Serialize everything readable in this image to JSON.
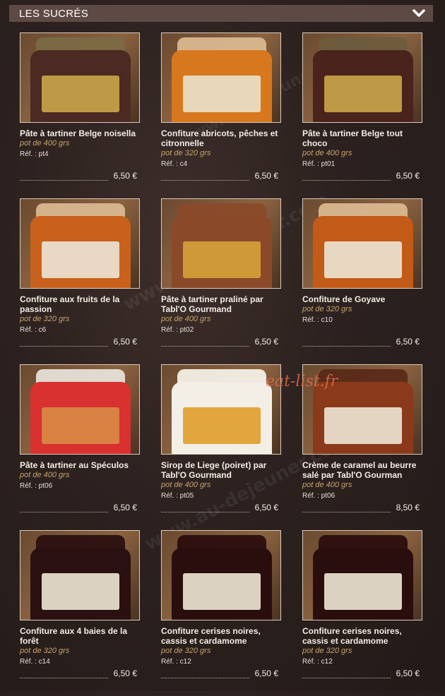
{
  "section": {
    "title": "LES SUCRÉS"
  },
  "watermark": "www.au-dejeuner.com",
  "overlay_logo": "eat-list.fr",
  "products": [
    {
      "name": "Pâte à tartiner Belge noisella",
      "weight": "pot de 400 grs",
      "ref": "Réf. : pt4",
      "price": "6,50 €",
      "jar": "#4a2a22",
      "label": "#c8a44a",
      "lid": "#7a6a44"
    },
    {
      "name": "Confiture abricots, pêches et citronnelle",
      "weight": "pot de 320 grs",
      "ref": "Réf. : c4",
      "price": "6,50 €",
      "jar": "#d7781e",
      "label": "#eadfc8",
      "lid": "#d9b890"
    },
    {
      "name": "Pâte à tartiner Belge tout choco",
      "weight": "pot de 400 grs",
      "ref": "Réf. : pt01",
      "price": "6,50 €",
      "jar": "#4a241c",
      "label": "#c8a44a",
      "lid": "#6d5c3d"
    },
    {
      "name": "Confiture aux fruits de la passion",
      "weight": "pot de 320 grs",
      "ref": "Réf. : c6",
      "price": "6,50 €",
      "jar": "#c8611c",
      "label": "#ece3d1",
      "lid": "#d9b890"
    },
    {
      "name": "Pâte à tartiner praliné par Tabl'O Gourmand",
      "weight": "pot de 400 grs",
      "ref": "Réf. : pt02",
      "price": "6,50 €",
      "jar": "#8a4a2a",
      "label": "#d6a03a",
      "lid": "#8a4a2a"
    },
    {
      "name": "Confiture de Goyave",
      "weight": "pot de 320 grs",
      "ref": "Réf. : c10",
      "price": "6,50 €",
      "jar": "#c25a18",
      "label": "#ece3d1",
      "lid": "#d9b890"
    },
    {
      "name": "Pâte à tartiner au Spéculos",
      "weight": "pot de 400 grs",
      "ref": "Réf. : pt06",
      "price": "6,50 €",
      "jar": "#d93030",
      "label": "#d98a45",
      "lid": "#e6e0d8"
    },
    {
      "name": "Sirop de Liege (poiret) par Tabl'O Gourmand",
      "weight": "pot de 400 grs",
      "ref": "Réf. : pt05",
      "price": "6,50 €",
      "jar": "#f3efe6",
      "label": "#e0a030",
      "lid": "#f3efe6"
    },
    {
      "name": "Crème de caramel au beurre salé par Tabl'O Gourman",
      "weight": "pot de 400 grs",
      "ref": "Réf. : pt06",
      "price": "8,50 €",
      "jar": "#8a3a1a",
      "label": "#ece3d1",
      "lid": "#5a2a18"
    },
    {
      "name": "Confiture aux 4 baies de la forêt",
      "weight": "pot de 320 grs",
      "ref": "Réf. : c14",
      "price": "6,50 €",
      "jar": "#2a1010",
      "label": "#ece3d1",
      "lid": "#2a1010"
    },
    {
      "name": "Confiture cerises noires, cassis et cardamome",
      "weight": "pot de 320 grs",
      "ref": "Réf. : c12",
      "price": "6,50 €",
      "jar": "#2a0e0e",
      "label": "#ece3d1",
      "lid": "#2a0e0e"
    },
    {
      "name": "Confiture cerises noires, cassis et cardamome",
      "weight": "pot de 320 grs",
      "ref": "Réf. : c12",
      "price": "6,50 €",
      "jar": "#2a0e0e",
      "label": "#ece3d1",
      "lid": "#2a0e0e"
    }
  ]
}
